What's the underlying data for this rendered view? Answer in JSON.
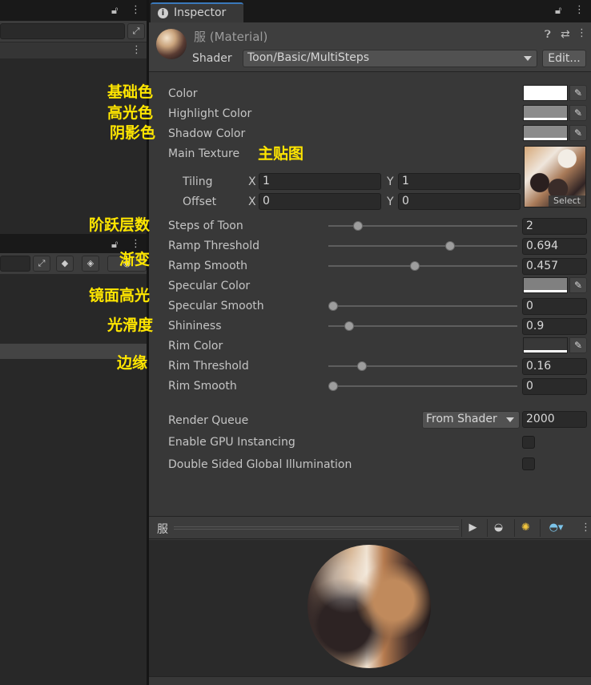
{
  "inspector": {
    "tab_title": "Inspector",
    "material_name": "服 (Material)",
    "shader_label": "Shader",
    "shader_value": "Toon/Basic/MultiSteps",
    "edit_label": "Edit..."
  },
  "properties": {
    "color": "Color",
    "highlight_color": "Highlight Color",
    "shadow_color": "Shadow Color",
    "main_texture": "Main Texture",
    "tiling": "Tiling",
    "offset": "Offset",
    "tiling_x": "1",
    "tiling_y": "1",
    "offset_x": "0",
    "offset_y": "0",
    "axis_x": "X",
    "axis_y": "Y",
    "texture_select": "Select",
    "steps_of_toon": "Steps of Toon",
    "steps_of_toon_value": "2",
    "ramp_threshold": "Ramp Threshold",
    "ramp_threshold_value": "0.694",
    "ramp_smooth": "Ramp Smooth",
    "ramp_smooth_value": "0.457",
    "specular_color": "Specular Color",
    "specular_smooth": "Specular Smooth",
    "specular_smooth_value": "0",
    "shininess": "Shininess",
    "shininess_value": "0.9",
    "rim_color": "Rim Color",
    "rim_threshold": "Rim Threshold",
    "rim_threshold_value": "0.16",
    "rim_smooth": "Rim Smooth",
    "rim_smooth_value": "0",
    "render_queue": "Render Queue",
    "render_queue_mode": "From Shader",
    "render_queue_value": "2000",
    "enable_gpu_instancing": "Enable GPU Instancing",
    "double_sided_gi": "Double Sided Global Illumination"
  },
  "sliders": {
    "steps_of_toon": 0.14,
    "ramp_threshold": 0.65,
    "ramp_smooth": 0.457,
    "specular_smooth": 0.0,
    "shininess": 0.09,
    "rim_threshold": 0.16,
    "rim_smooth": 0.0
  },
  "colors": {
    "color": "#ffffff",
    "highlight_color": "#8c8c8c",
    "shadow_color": "#8c8c8c",
    "specular_color": "#808080",
    "rim_color": "#383838",
    "accent": "#3a79bb",
    "annotation": "#ffe600"
  },
  "annotations": {
    "base_color": "基础色",
    "highlight": "高光色",
    "shadow": "阴影色",
    "main_texture": "主贴图",
    "toon_steps": "阶跃层数",
    "ramp": "渐变",
    "specular": "镜面高光",
    "smoothness": "光滑度",
    "rim": "边缘"
  },
  "preview": {
    "title": "服"
  }
}
